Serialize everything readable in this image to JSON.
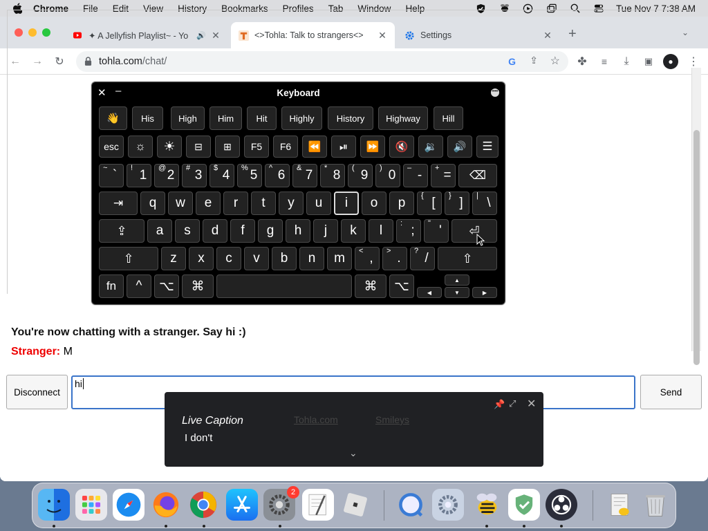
{
  "menubar": {
    "app_name": "Chrome",
    "items": [
      "File",
      "Edit",
      "View",
      "History",
      "Bookmarks",
      "Profiles",
      "Tab",
      "Window",
      "Help"
    ],
    "clock": "Tue Nov 7  7:38 AM"
  },
  "tabs": [
    {
      "title": "✦ A Jellyfish Playlist~ - Yo",
      "favicon": "youtube-icon",
      "audio": true
    },
    {
      "title": "<>Tohla: Talk to strangers<>",
      "favicon": "tohla-icon",
      "active": true
    },
    {
      "title": "Settings",
      "favicon": "gear-icon"
    }
  ],
  "omnibox": {
    "domain": "tohla.com",
    "path": "/chat/"
  },
  "keyboard": {
    "title": "Keyboard",
    "suggestions": [
      "👋",
      "His",
      "High",
      "Him",
      "Hit",
      "Highly",
      "History",
      "Highway",
      "Hill"
    ],
    "function_row": [
      "esc",
      "F5",
      "F6"
    ],
    "number_row": [
      {
        "main": "1",
        "shift": "!"
      },
      {
        "main": "2",
        "shift": "@"
      },
      {
        "main": "3",
        "shift": "#"
      },
      {
        "main": "4",
        "shift": "$"
      },
      {
        "main": "5",
        "shift": "%"
      },
      {
        "main": "6",
        "shift": "^"
      },
      {
        "main": "7",
        "shift": "&"
      },
      {
        "main": "8",
        "shift": "*"
      },
      {
        "main": "9",
        "shift": "("
      },
      {
        "main": "0",
        "shift": ")"
      },
      {
        "main": "-",
        "shift": "–"
      },
      {
        "main": "=",
        "shift": "+"
      }
    ],
    "backtick": {
      "main": "`",
      "shift": "~"
    },
    "row_q": [
      "q",
      "w",
      "e",
      "r",
      "t",
      "y",
      "u",
      "i",
      "o",
      "p"
    ],
    "row_q_brackets": [
      {
        "main": "[",
        "shift": "{"
      },
      {
        "main": "]",
        "shift": "}"
      },
      {
        "main": "\\",
        "shift": "|"
      }
    ],
    "row_a": [
      "a",
      "s",
      "d",
      "f",
      "g",
      "h",
      "j",
      "k",
      "l"
    ],
    "row_a_punct": [
      {
        "main": ";",
        "shift": ":"
      },
      {
        "main": "'",
        "shift": "\""
      }
    ],
    "row_z": [
      "z",
      "x",
      "c",
      "v",
      "b",
      "n",
      "m"
    ],
    "row_z_punct": [
      {
        "main": ",",
        "shift": "<"
      },
      {
        "main": ".",
        "shift": ">"
      },
      {
        "main": "/",
        "shift": "?"
      }
    ],
    "bottom": {
      "fn": "fn",
      "ctrl": "^",
      "opt": "⌥",
      "cmd": "⌘"
    },
    "highlighted_key": "i"
  },
  "chat": {
    "status": "You're now chatting with a stranger. Say hi :)",
    "stranger_label": "Stranger:",
    "stranger_msg": "M",
    "input_value": "hi",
    "disconnect_label": "Disconnect",
    "send_label": "Send"
  },
  "caption": {
    "title": "Live Caption",
    "text": "I don't",
    "ghost_links": [
      "Tohla.com",
      "Smileys"
    ]
  },
  "dock": {
    "settings_badge": "2"
  }
}
